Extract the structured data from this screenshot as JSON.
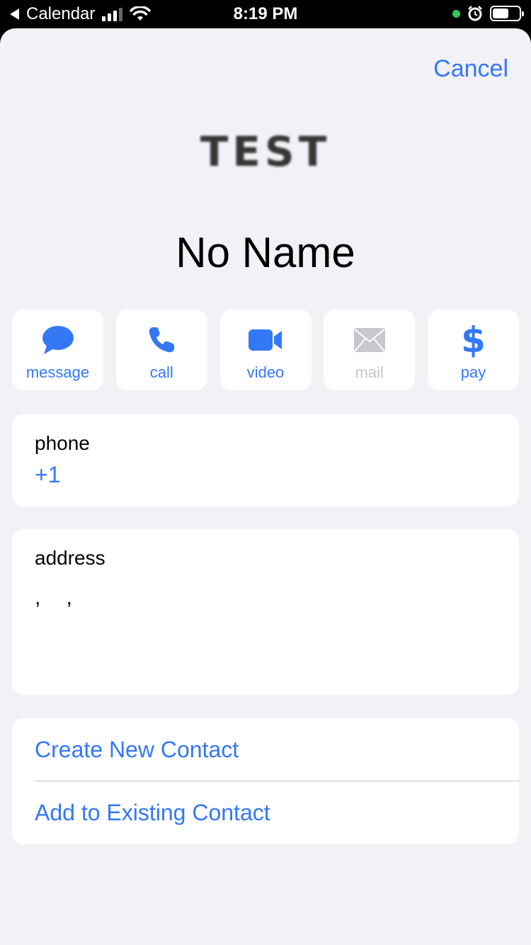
{
  "status_bar": {
    "back_app": "Calendar",
    "time": "8:19 PM",
    "battery_percent": 60,
    "indicator_color": "#34c759"
  },
  "header": {
    "cancel_label": "Cancel",
    "logo_text": "TEST",
    "contact_name": "No Name"
  },
  "actions": [
    {
      "label": "message",
      "icon": "message-bubble-icon",
      "enabled": true
    },
    {
      "label": "call",
      "icon": "phone-icon",
      "enabled": true
    },
    {
      "label": "video",
      "icon": "video-camera-icon",
      "enabled": true
    },
    {
      "label": "mail",
      "icon": "mail-envelope-icon",
      "enabled": false
    },
    {
      "label": "pay",
      "icon": "dollar-icon",
      "enabled": true
    }
  ],
  "phone": {
    "label": "phone",
    "value": "+1"
  },
  "address": {
    "label": "address",
    "value": ", ,"
  },
  "options": {
    "create_label": "Create New Contact",
    "add_label": "Add to Existing Contact"
  },
  "colors": {
    "accent": "#3478f6",
    "background": "#f1f1f6",
    "disabled": "#c7c7cc"
  }
}
